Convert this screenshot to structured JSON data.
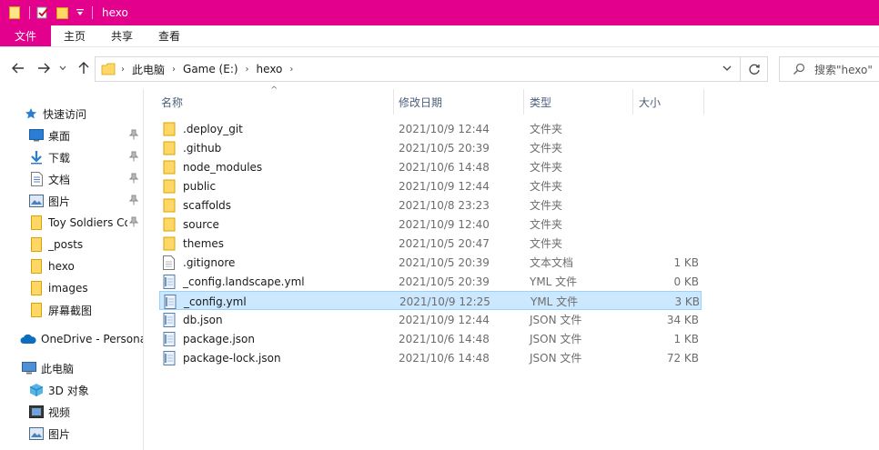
{
  "window": {
    "title": "hexo"
  },
  "colors": {
    "accent": "#e3008c",
    "folder": "#ffd766",
    "selection": "#cce8ff"
  },
  "ribbon": {
    "tabs": [
      "文件",
      "主页",
      "共享",
      "查看"
    ]
  },
  "address": {
    "crumbs": [
      "此电脑",
      "Game (E:)",
      "hexo"
    ]
  },
  "search": {
    "placeholder": "搜索\"hexo\""
  },
  "sidebar": {
    "quick_access": "快速访问",
    "pinned": [
      {
        "label": "桌面",
        "icon": "desktop-icon"
      },
      {
        "label": "下载",
        "icon": "download-icon"
      },
      {
        "label": "文档",
        "icon": "document-icon"
      },
      {
        "label": "图片",
        "icon": "picture-icon"
      },
      {
        "label": "Toy Soldiers Co",
        "icon": "folder-icon"
      }
    ],
    "folders": [
      "_posts",
      "hexo",
      "images",
      "屏幕截图"
    ],
    "onedrive": "OneDrive - Persona",
    "this_pc": "此电脑",
    "pc_items": [
      {
        "label": "3D 对象",
        "icon": "3d-objects-icon"
      },
      {
        "label": "视频",
        "icon": "video-icon"
      },
      {
        "label": "图片",
        "icon": "picture-icon"
      }
    ]
  },
  "columns": {
    "name": "名称",
    "date": "修改日期",
    "type": "类型",
    "size": "大小"
  },
  "files": [
    {
      "name": ".deploy_git",
      "date": "2021/10/9 12:44",
      "type": "文件夹",
      "size": "",
      "kind": "folder"
    },
    {
      "name": ".github",
      "date": "2021/10/5 20:39",
      "type": "文件夹",
      "size": "",
      "kind": "folder"
    },
    {
      "name": "node_modules",
      "date": "2021/10/6 14:48",
      "type": "文件夹",
      "size": "",
      "kind": "folder"
    },
    {
      "name": "public",
      "date": "2021/10/9 12:44",
      "type": "文件夹",
      "size": "",
      "kind": "folder"
    },
    {
      "name": "scaffolds",
      "date": "2021/10/8 23:23",
      "type": "文件夹",
      "size": "",
      "kind": "folder"
    },
    {
      "name": "source",
      "date": "2021/10/9 12:40",
      "type": "文件夹",
      "size": "",
      "kind": "folder"
    },
    {
      "name": "themes",
      "date": "2021/10/5 20:47",
      "type": "文件夹",
      "size": "",
      "kind": "folder"
    },
    {
      "name": ".gitignore",
      "date": "2021/10/5 20:39",
      "type": "文本文档",
      "size": "1 KB",
      "kind": "text"
    },
    {
      "name": "_config.landscape.yml",
      "date": "2021/10/5 20:39",
      "type": "YML 文件",
      "size": "0 KB",
      "kind": "file"
    },
    {
      "name": "_config.yml",
      "date": "2021/10/9 12:25",
      "type": "YML 文件",
      "size": "3 KB",
      "kind": "file",
      "selected": true
    },
    {
      "name": "db.json",
      "date": "2021/10/9 12:44",
      "type": "JSON 文件",
      "size": "34 KB",
      "kind": "file"
    },
    {
      "name": "package.json",
      "date": "2021/10/6 14:48",
      "type": "JSON 文件",
      "size": "1 KB",
      "kind": "file"
    },
    {
      "name": "package-lock.json",
      "date": "2021/10/6 14:48",
      "type": "JSON 文件",
      "size": "72 KB",
      "kind": "file"
    }
  ]
}
